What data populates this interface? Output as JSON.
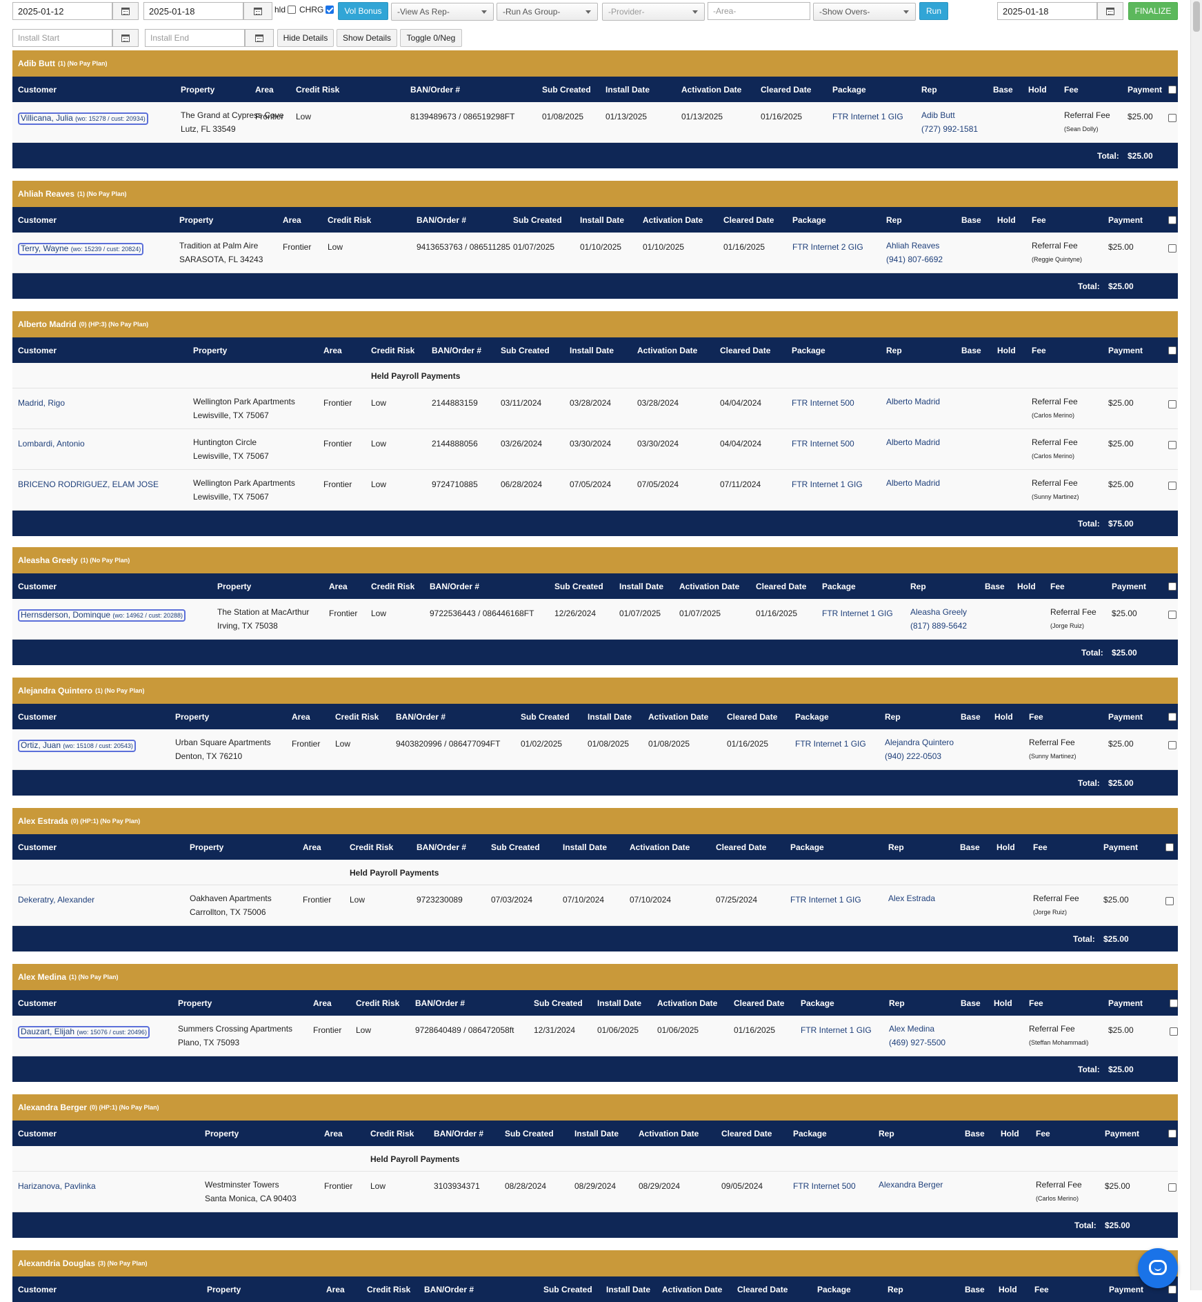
{
  "toolbar": {
    "date_start": "2025-01-12",
    "date_end": "2025-01-18",
    "hld_label": "hld",
    "chrg_label": "CHRG",
    "vol_bonus": "Vol Bonus",
    "view_as_rep": "-View As Rep-",
    "run_as_group": "-Run As Group-",
    "provider": "-Provider-",
    "area_placeholder": "-Area-",
    "show_overs": "-Show Overs-",
    "run": "Run",
    "finalize_date": "2025-01-18",
    "finalize": "FINALIZE",
    "install_start_placeholder": "Install Start",
    "install_end_placeholder": "Install End",
    "hide_details": "Hide Details",
    "show_details": "Show Details",
    "toggle_neg": "Toggle 0/Neg"
  },
  "columns": {
    "customer": "Customer",
    "property": "Property",
    "area": "Area",
    "credit_risk": "Credit Risk",
    "ban": "BAN/Order #",
    "sub_created": "Sub Created",
    "install_date": "Install Date",
    "activation_date": "Activation Date",
    "cleared_date": "Cleared Date",
    "package": "Package",
    "rep": "Rep",
    "base": "Base",
    "hold": "Hold",
    "fee": "Fee",
    "payment": "Payment"
  },
  "held_label": "Held Payroll Payments",
  "total_label": "Total:",
  "groups": [
    {
      "name": "Adib Butt",
      "meta": "(1) (No Pay Plan)",
      "total": "$25.00",
      "rows": [
        {
          "customer": "Villicana, Julia",
          "wo": "(wo: 15278 / cust: 20934)",
          "property1": "The Grand at Cypress Cove",
          "property2": "Lutz, FL 33549",
          "area": "Frontier",
          "risk": "Low",
          "ban": "8139489673 / 086519298FT",
          "sub": "01/08/2025",
          "install": "01/13/2025",
          "activation": "01/13/2025",
          "cleared": "01/16/2025",
          "package": "FTR Internet 1 GIG",
          "rep": "Adib Butt",
          "rep_phone": "(727) 992-1581",
          "fee": "Referral Fee",
          "fee_by": "(Sean Dolly)",
          "payment": "$25.00"
        }
      ]
    },
    {
      "name": "Ahliah Reaves",
      "meta": "(1) (No Pay Plan)",
      "total": "$25.00",
      "rows": [
        {
          "customer": "Terry, Wayne",
          "wo": "(wo: 15239 / cust: 20824)",
          "property1": "Tradition at Palm Aire",
          "property2": "SARASOTA, FL 34243",
          "area": "Frontier",
          "risk": "Low",
          "ban": "9413653763 / 086511285",
          "sub": "01/07/2025",
          "install": "01/10/2025",
          "activation": "01/10/2025",
          "cleared": "01/16/2025",
          "package": "FTR Internet 2 GIG",
          "rep": "Ahliah Reaves",
          "rep_phone": "(941) 807-6692",
          "fee": "Referral Fee",
          "fee_by": "(Reggie Quintyne)",
          "payment": "$25.00"
        }
      ]
    },
    {
      "name": "Alberto Madrid",
      "meta": "(0) (HP:3) (No Pay Plan)",
      "total": "$75.00",
      "rows": [
        {
          "customer": "Madrid, Rigo",
          "property1": "Wellington Park Apartments",
          "property2": "Lewisville, TX 75067",
          "area": "Frontier",
          "risk": "Low",
          "ban": "2144883159",
          "sub": "03/11/2024",
          "install": "03/28/2024",
          "activation": "03/28/2024",
          "cleared": "04/04/2024",
          "package": "FTR Internet 500",
          "rep": "Alberto Madrid",
          "fee": "Referral Fee",
          "fee_by": "(Carlos Merino)",
          "payment": "$25.00"
        },
        {
          "customer": "Lombardi, Antonio",
          "property1": "Huntington Circle",
          "property2": "Lewisville, TX 75067",
          "area": "Frontier",
          "risk": "Low",
          "ban": "2144888056",
          "sub": "03/26/2024",
          "install": "03/30/2024",
          "activation": "03/30/2024",
          "cleared": "04/04/2024",
          "package": "FTR Internet 500",
          "rep": "Alberto Madrid",
          "fee": "Referral Fee",
          "fee_by": "(Carlos Merino)",
          "payment": "$25.00"
        },
        {
          "customer": "BRICENO RODRIGUEZ, ELAM JOSE",
          "property1": "Wellington Park Apartments",
          "property2": "Lewisville, TX 75067",
          "area": "Frontier",
          "risk": "Low",
          "ban": "9724710885",
          "sub": "06/28/2024",
          "install": "07/05/2024",
          "activation": "07/05/2024",
          "cleared": "07/11/2024",
          "package": "FTR Internet 1 GIG",
          "rep": "Alberto Madrid",
          "fee": "Referral Fee",
          "fee_by": "(Sunny Martinez)",
          "payment": "$25.00"
        }
      ]
    },
    {
      "name": "Aleasha Greely",
      "meta": "(1) (No Pay Plan)",
      "total": "$25.00",
      "rows": [
        {
          "customer": "Hernsderson, Dominque",
          "wo": "(wo: 14962 / cust: 20288)",
          "property1": "The Station at MacArthur",
          "property2": "Irving, TX 75038",
          "area": "Frontier",
          "risk": "Low",
          "ban": "9722536443 / 086446168FT",
          "sub": "12/26/2024",
          "install": "01/07/2025",
          "activation": "01/07/2025",
          "cleared": "01/16/2025",
          "package": "FTR Internet 1 GIG",
          "rep": "Aleasha Greely",
          "rep_phone": "(817) 889-5642",
          "fee": "Referral Fee",
          "fee_by": "(Jorge Ruiz)",
          "payment": "$25.00"
        }
      ]
    },
    {
      "name": "Alejandra Quintero",
      "meta": "(1) (No Pay Plan)",
      "total": "$25.00",
      "rows": [
        {
          "customer": "Ortiz, Juan",
          "wo": "(wo: 15108 / cust: 20543)",
          "property1": "Urban Square Apartments",
          "property2": "Denton, TX 76210",
          "area": "Frontier",
          "risk": "Low",
          "ban": "9403820996 / 086477094FT",
          "sub": "01/02/2025",
          "install": "01/08/2025",
          "activation": "01/08/2025",
          "cleared": "01/16/2025",
          "package": "FTR Internet 1 GIG",
          "rep": "Alejandra Quintero",
          "rep_phone": "(940) 222-0503",
          "fee": "Referral Fee",
          "fee_by": "(Sunny Martinez)",
          "payment": "$25.00"
        }
      ]
    },
    {
      "name": "Alex Estrada",
      "meta": "(0) (HP:1) (No Pay Plan)",
      "total": "$25.00",
      "rows": [
        {
          "customer": "Dekeratry, Alexander",
          "property1": "Oakhaven Apartments",
          "property2": "Carrollton, TX 75006",
          "area": "Frontier",
          "risk": "Low",
          "ban": "9723230089",
          "sub": "07/03/2024",
          "install": "07/10/2024",
          "activation": "07/10/2024",
          "cleared": "07/25/2024",
          "package": "FTR Internet 1 GIG",
          "rep": "Alex Estrada",
          "fee": "Referral Fee",
          "fee_by": "(Jorge Ruiz)",
          "payment": "$25.00"
        }
      ]
    },
    {
      "name": "Alex Medina",
      "meta": "(1) (No Pay Plan)",
      "total": "$25.00",
      "rows": [
        {
          "customer": "Dauzart, Elijah",
          "wo": "(wo: 15076 / cust: 20496)",
          "property1": "Summers Crossing Apartments",
          "property2": "Plano, TX 75093",
          "area": "Frontier",
          "risk": "Low",
          "ban": "9728640489 / 086472058ft",
          "sub": "12/31/2024",
          "install": "01/06/2025",
          "activation": "01/06/2025",
          "cleared": "01/16/2025",
          "package": "FTR Internet 1 GIG",
          "rep": "Alex Medina",
          "rep_phone": "(469) 927-5500",
          "fee": "Referral Fee",
          "fee_by": "(Steffan Mohammadi)",
          "payment": "$25.00"
        }
      ]
    },
    {
      "name": "Alexandra Berger",
      "meta": "(0) (HP:1) (No Pay Plan)",
      "total": "$25.00",
      "rows": [
        {
          "customer": "Harizanova, Pavlinka",
          "property1": "Westminster Towers",
          "property2": "Santa Monica, CA 90403",
          "area": "Frontier",
          "risk": "Low",
          "ban": "3103934371",
          "sub": "08/28/2024",
          "install": "08/29/2024",
          "activation": "08/29/2024",
          "cleared": "09/05/2024",
          "package": "FTR Internet 500",
          "rep": "Alexandra Berger",
          "fee": "Referral Fee",
          "fee_by": "(Carlos Merino)",
          "payment": "$25.00"
        }
      ]
    },
    {
      "name": "Alexandria Douglas",
      "meta": "(3) (No Pay Plan)",
      "total": "",
      "rows": []
    }
  ],
  "icons": {
    "calendar": "calendar-icon",
    "chat": "chat-icon"
  },
  "colors": {
    "group_header": "#c9993a",
    "table_header": "#0f2756",
    "run_button": "#31a5d6",
    "finalize_button": "#5cb85c"
  }
}
